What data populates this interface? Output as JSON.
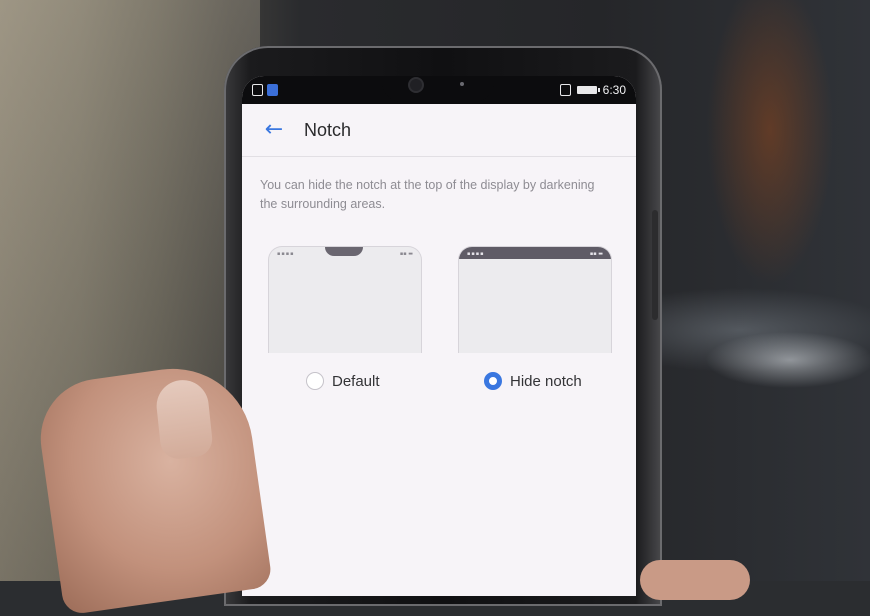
{
  "status_bar": {
    "time": "6:30"
  },
  "header": {
    "back_label": "←",
    "title": "Notch"
  },
  "description": "You can hide the notch at the top of the display by darkening the surrounding areas.",
  "options": [
    {
      "label": "Default",
      "selected": false
    },
    {
      "label": "Hide notch",
      "selected": true
    }
  ],
  "colors": {
    "accent": "#3a77e0",
    "screen_bg": "#f7f4f8"
  }
}
